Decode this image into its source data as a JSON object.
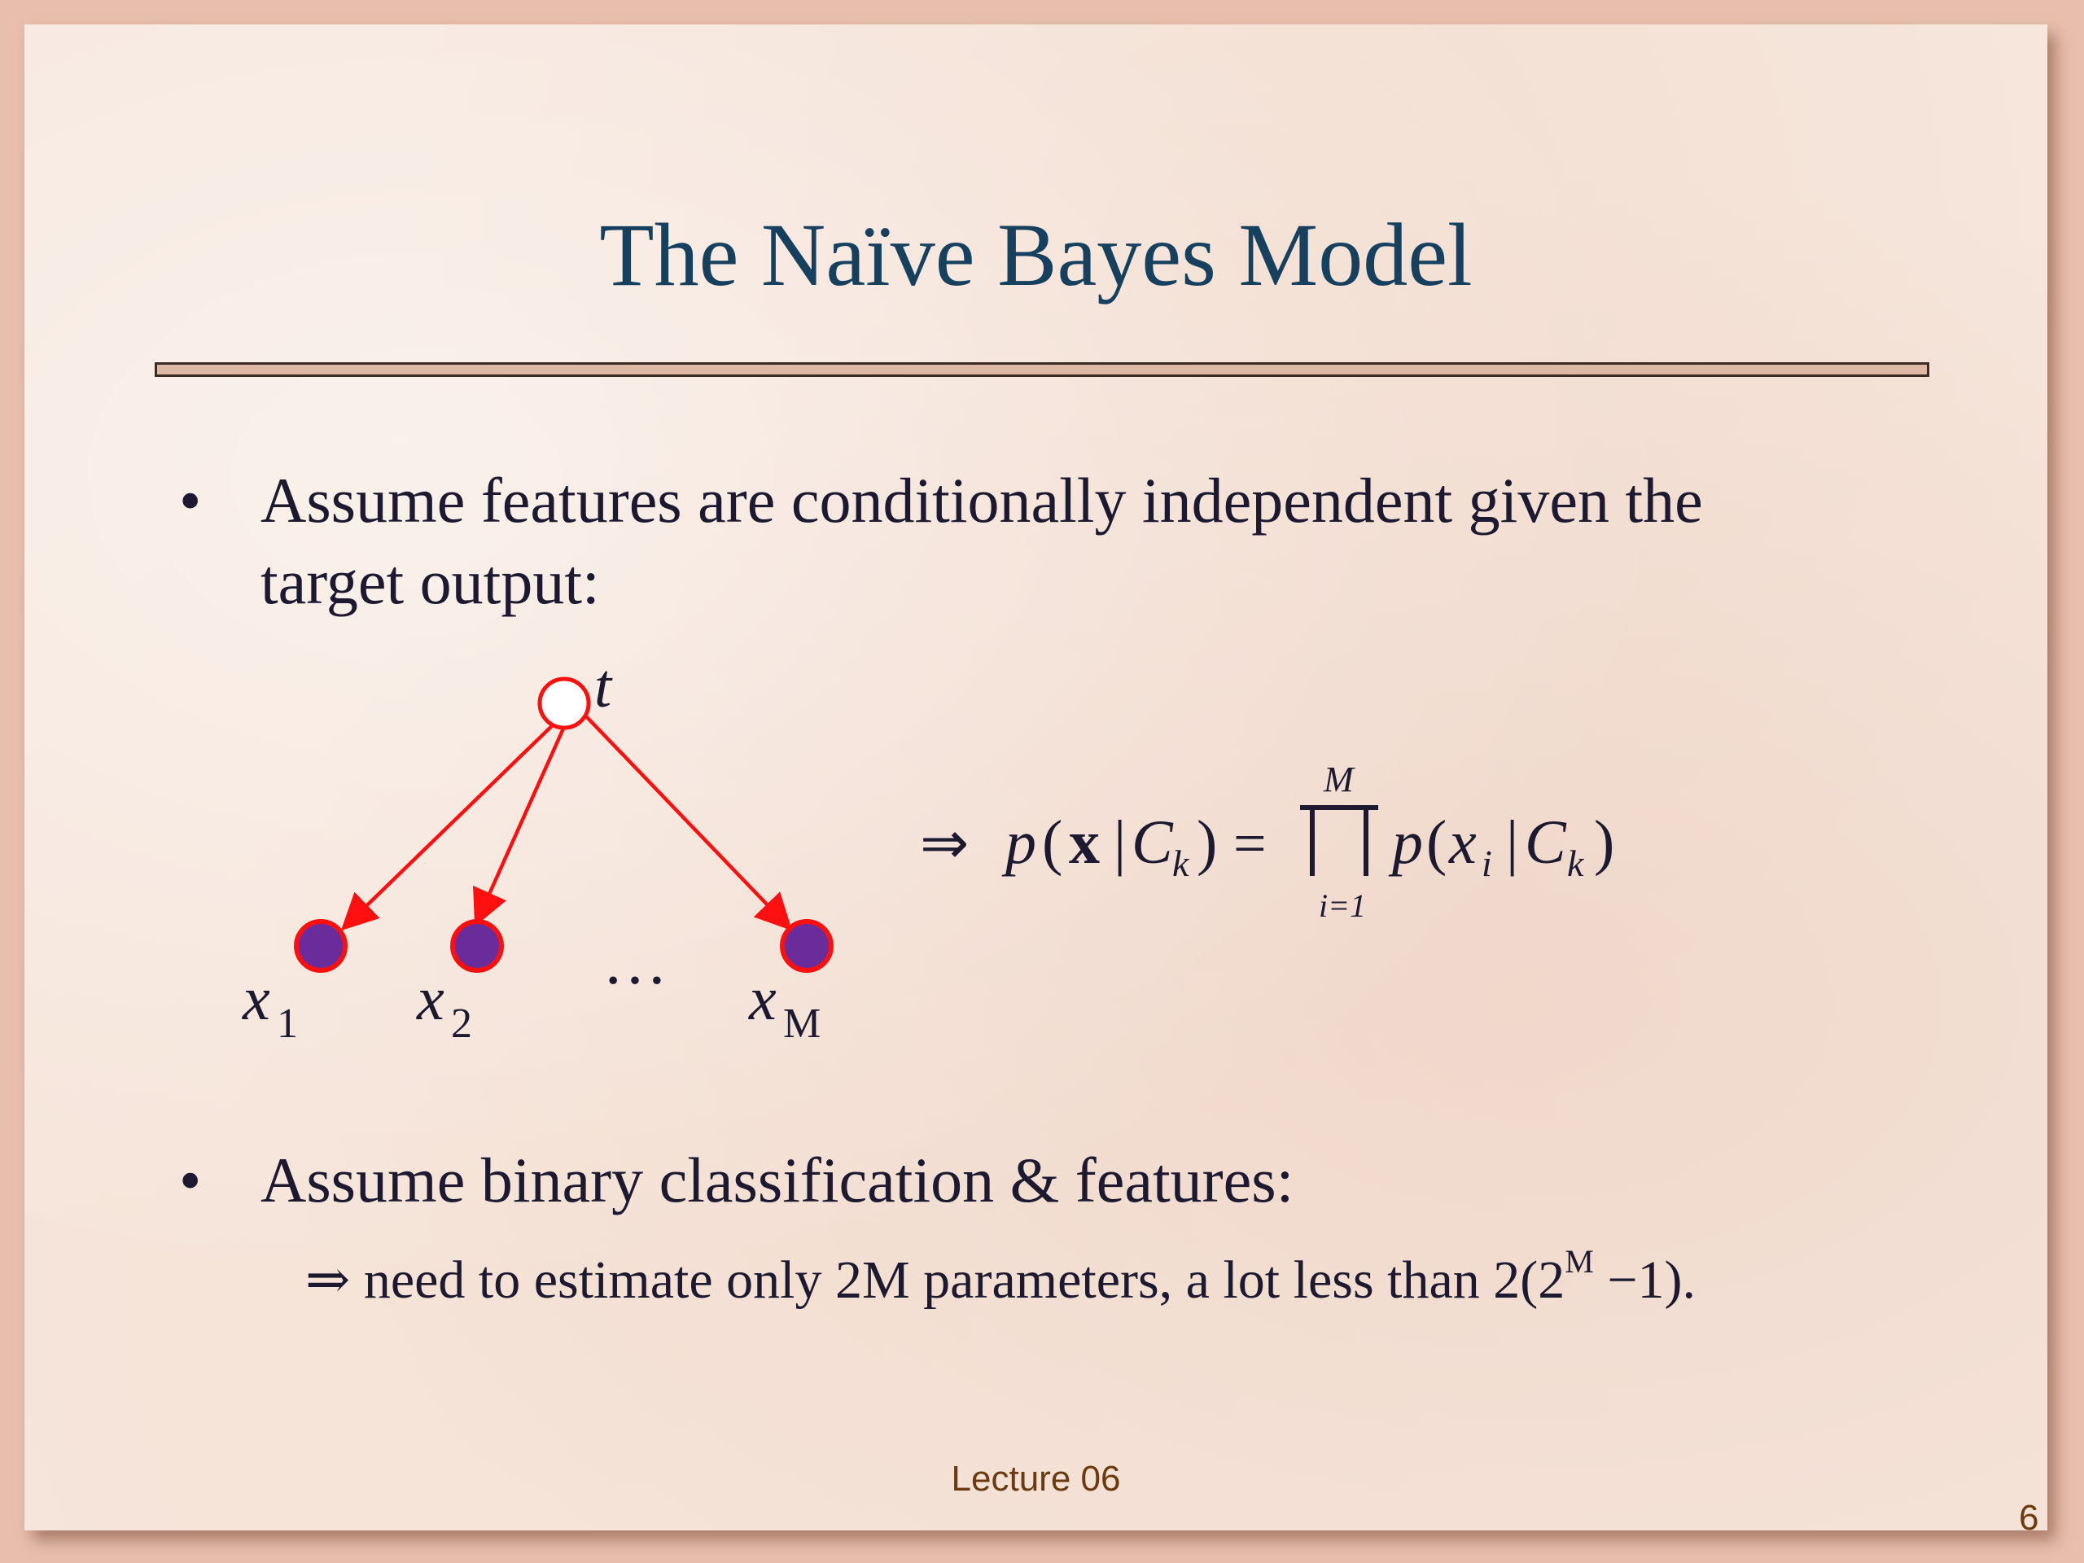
{
  "slide": {
    "title": "The Naïve Bayes Model",
    "bullet_char": "•",
    "bullets": [
      {
        "line1": "Assume features are conditionally independent given the",
        "line2": "target output:"
      },
      {
        "line1": "Assume binary classification & features:"
      }
    ],
    "sub_bullet": {
      "arrow": "⇒",
      "text_before": "need to estimate only 2M parameters, a lot less than 2(2",
      "superscript": "M",
      "text_after": " −1)."
    },
    "footer": "Lecture 06",
    "page_number": "6"
  },
  "diagram": {
    "parent_label": "t",
    "children": [
      {
        "var": "x",
        "sub": "1"
      },
      {
        "var": "x",
        "sub": "2"
      },
      {
        "var": "x",
        "sub": "M"
      }
    ],
    "ellipsis": "…",
    "colors": {
      "edge": "#ff1010",
      "child_fill": "#6a2c9a",
      "parent_fill": "#ffffff"
    }
  },
  "formula": {
    "implies": "⇒",
    "lhs_p": "p",
    "lhs_x": "x",
    "bar": "|",
    "C": "C",
    "k": "k",
    "equals": "=",
    "prod_upper": "M",
    "prod_lower": "i=1",
    "rhs_p": "p",
    "rhs_x": "x",
    "rhs_i": "i"
  }
}
